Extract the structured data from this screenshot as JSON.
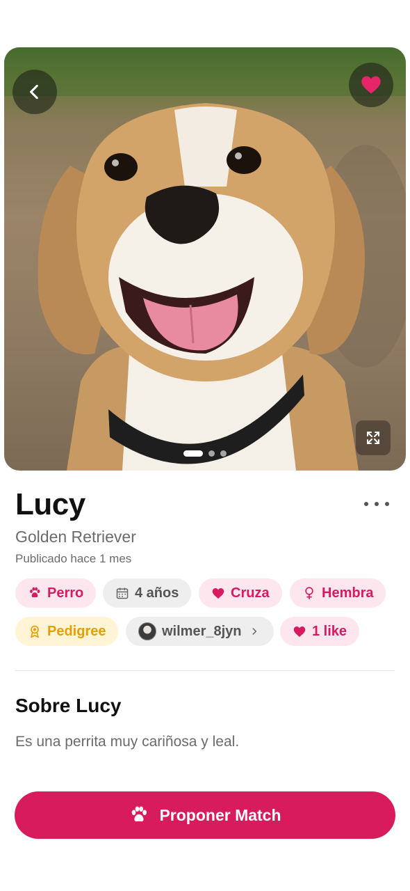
{
  "pet": {
    "name": "Lucy",
    "breed": "Golden Retriever",
    "published": "Publicado hace 1 mes"
  },
  "gallery": {
    "image_count": 3,
    "active_index": 0
  },
  "chips": {
    "species": "Perro",
    "age": "4 años",
    "purpose": "Cruza",
    "sex": "Hembra",
    "pedigree": "Pedigree",
    "owner": "wilmer_8jyn",
    "likes": "1 like"
  },
  "about": {
    "title": "Sobre Lucy",
    "text": "Es una perrita muy cariñosa y leal."
  },
  "cta": {
    "label": "Proponer Match"
  },
  "colors": {
    "accent": "#d81b5c",
    "pink_chip_bg": "#fde6ee",
    "yellow_chip_text": "#e5a000"
  },
  "icons": [
    "chevron-left-icon",
    "heart-icon",
    "expand-icon",
    "more-icon",
    "paw-icon",
    "calendar-icon",
    "female-icon",
    "award-icon",
    "chevron-right-icon"
  ]
}
